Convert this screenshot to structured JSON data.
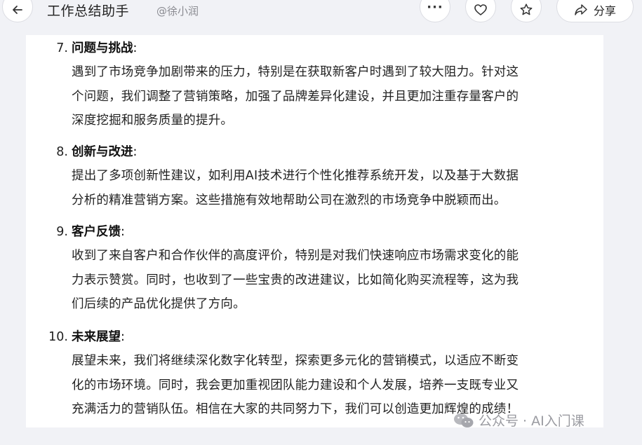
{
  "header": {
    "title": "工作总结助手",
    "author": "@徐小润",
    "share_label": "分享",
    "more_label": "···"
  },
  "items": [
    {
      "number": "7.",
      "heading": "问题与挑战",
      "colon": ":",
      "lines": [
        "遇到了市场竞争加剧带来的压力，特别是在获取新客户时遇到了较大阻力。针对这",
        "个问题，我们调整了营销策略，加强了品牌差异化建设，并且更加注重存量客户的",
        "深度挖掘和服务质量的提升。"
      ]
    },
    {
      "number": "8.",
      "heading": "创新与改进",
      "colon": ":",
      "lines": [
        "提出了多项创新性建议，如利用AI技术进行个性化推荐系统开发，以及基于大数据",
        "分析的精准营销方案。这些措施有效地帮助公司在激烈的市场竞争中脱颖而出。"
      ]
    },
    {
      "number": "9.",
      "heading": "客户反馈",
      "colon": ":",
      "lines": [
        "收到了来自客户和合作伙伴的高度评价，特别是对我们快速响应市场需求变化的能",
        "力表示赞赏。同时，也收到了一些宝贵的改进建议，比如简化购买流程等，这为我",
        "们后续的产品优化提供了方向。"
      ]
    },
    {
      "number": "10.",
      "heading": "未来展望",
      "colon": ":",
      "lines": [
        "展望未来，我们将继续深化数字化转型，探索更多元化的营销模式，以适应不断变",
        "化的市场环境。同时，我会更加重视团队能力建设和个人发展，培养一支既专业又",
        "充满活力的营销队伍。相信在大家的共同努力下，我们可以创造更加辉煌的成绩！"
      ]
    }
  ],
  "watermark": {
    "text": "公众号 · AI入门课"
  }
}
